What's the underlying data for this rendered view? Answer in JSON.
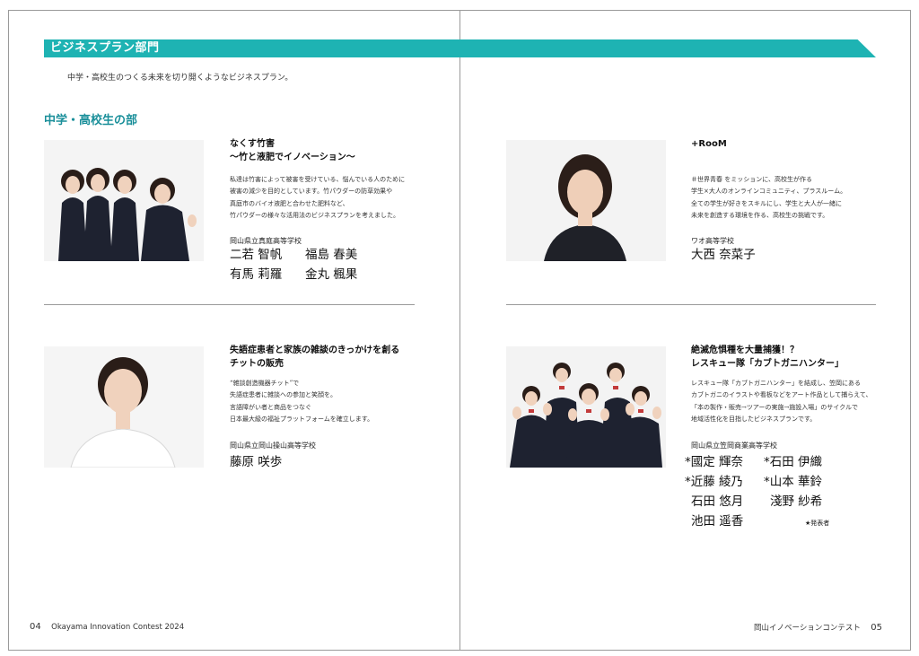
{
  "header": {
    "category": "ビジネスプラン部門",
    "lead": "中学・高校生のつくる未来を切り開くようなビジネスプラン。",
    "section": "中学・高校生の部"
  },
  "entries": [
    {
      "title_lines": [
        "なくす竹害",
        "〜竹と液肥でイノベーション〜"
      ],
      "desc_lines": [
        "私達は竹害によって被害を受けている、悩んでいる人のために",
        "被害の減少を目的としています。竹パウダーの防草効果や",
        "真庭市のバイオ液肥と合わせた肥料など、",
        "竹パウダーの様々な活用法のビジネスプランを考えました。"
      ],
      "school": "岡山県立真庭高等学校",
      "members": [
        [
          "二若 智帆",
          "福島 春美"
        ],
        [
          "有馬 莉羅",
          "金丸 楓果"
        ]
      ],
      "photo_icon": "group-photo-icon"
    },
    {
      "title_lines": [
        "+RooM"
      ],
      "desc_lines": [
        "＃世界青春 をミッションに、高校生が作る",
        "学生×大人のオンラインコミュニティ、プラスルーム。",
        "全ての学生が好きをスキルにし、学生と大人が一緒に",
        "未来を創造する環境を作る、高校生の挑戦です。"
      ],
      "school": "ワオ高等学校",
      "members": [
        [
          "大西 奈菜子"
        ]
      ],
      "photo_icon": "portrait-photo-icon"
    },
    {
      "title_lines": [
        "失語症患者と家族の雑談のきっかけを創る",
        "チットの販売"
      ],
      "desc_lines": [
        "“雑談創造機器チット”で",
        "失語症患者に雑談への参加と笑顔を。",
        "言語障がい者と商品をつなぐ",
        "日本最大級の福祉プラットフォームを確立します。"
      ],
      "school": "岡山県立岡山操山高等学校",
      "members": [
        [
          "藤原 咲歩"
        ]
      ],
      "photo_icon": "portrait-photo-icon"
    },
    {
      "title_lines": [
        "絶滅危惧種を大量捕獲！？",
        "レスキュー隊「カブトガニハンター」"
      ],
      "desc_lines": [
        "レスキュー隊「カブトガニハンター」を結成し、笠岡にある",
        "カブトガニのイラストや看板などをアート作品として捕らえて、",
        "「本の製作・販売→ツアーの実施→施設入場」のサイクルで",
        "地域活性化を目指したビジネスプランです。"
      ],
      "school": "岡山県立笠岡商業高等学校",
      "members": [
        [
          "*國定 輝奈",
          "*石田 伊織"
        ],
        [
          "*近藤 綾乃",
          "*山本 華鈴"
        ],
        [
          "石田 悠月",
          "淺野 紗希"
        ],
        [
          "池田 遥香",
          ""
        ]
      ],
      "footnote": "★発表者",
      "photo_icon": "group-photo-icon"
    }
  ],
  "footer": {
    "left_page": "04",
    "left_text": "Okayama Innovation Contest 2024",
    "right_text": "岡山イノベーションコンテスト",
    "right_page": "05"
  },
  "colors": {
    "accent": "#1eb3b3",
    "section_title": "#1a8f9a",
    "rule": "#9a9a9a"
  }
}
